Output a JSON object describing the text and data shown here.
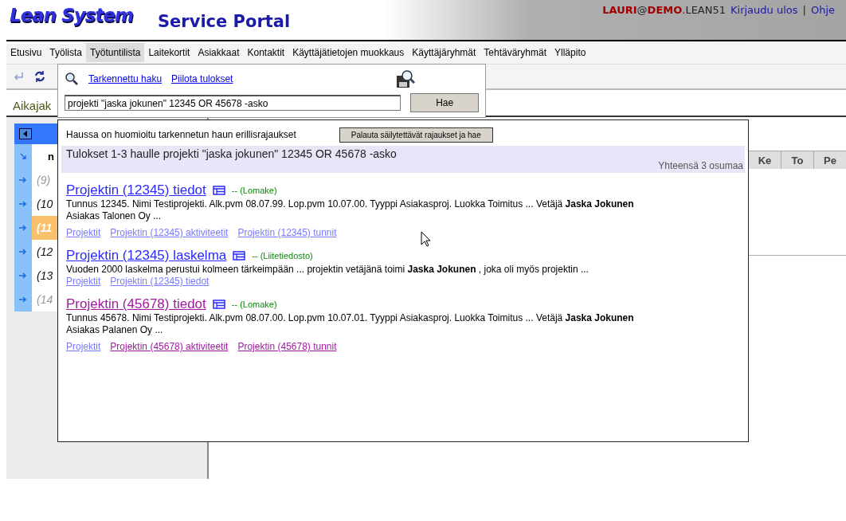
{
  "header": {
    "logo": "Lean System",
    "title": "Service Portal",
    "user": [
      {
        "text": "LAURI",
        "highlight": true
      },
      {
        "text": "@",
        "highlight": false
      },
      {
        "text": "DEMO",
        "highlight": true
      },
      {
        "text": ".LEAN51",
        "highlight": false
      }
    ],
    "links": [
      "Kirjaudu ulos",
      "Ohje"
    ],
    "separator": "|"
  },
  "menu": [
    {
      "label": "Etusivu",
      "selected": false
    },
    {
      "label": "Työlista",
      "selected": false
    },
    {
      "label": "Työtuntilista",
      "selected": true
    },
    {
      "label": "Laitekortit",
      "selected": false
    },
    {
      "label": "Asiakkaat",
      "selected": false
    },
    {
      "label": "Kontaktit",
      "selected": false
    },
    {
      "label": "Käyttäjätietojen muokkaus",
      "selected": false
    },
    {
      "label": "Käyttäjäryhmät",
      "selected": false
    },
    {
      "label": "Tehtäväryhmät",
      "selected": false
    },
    {
      "label": "Ylläpito",
      "selected": false
    }
  ],
  "tab_label": "Aikajak",
  "left_list": {
    "heading": "n",
    "rows": [
      {
        "label": "(9)",
        "selected": false,
        "dimmed": true
      },
      {
        "label": "(10",
        "selected": false,
        "dimmed": false
      },
      {
        "label": "(11",
        "selected": true,
        "dimmed": false
      },
      {
        "label": "(12",
        "selected": false,
        "dimmed": false
      },
      {
        "label": "(13",
        "selected": false,
        "dimmed": false
      },
      {
        "label": "(14",
        "selected": false,
        "dimmed": true
      }
    ]
  },
  "day_columns": [
    "Ke",
    "To",
    "Pe"
  ],
  "search": {
    "links": [
      "Tarkennettu haku",
      "Piilota tulokset"
    ],
    "value": "projekti \"jaska jokunen\" 12345 OR 45678 -asko",
    "button": "Hae"
  },
  "results": {
    "notice": "Haussa on huomioitu tarkennetun haun erillisrajaukset",
    "restore_button": "Palauta säilytettävät rajaukset ja hae",
    "summary": "Tulokset 1-3 haulle projekti \"jaska jokunen\" 12345 OR 45678 -asko",
    "count": "Yhteensä 3 osumaa",
    "items": [
      {
        "title": "Projektin (12345) tiedot",
        "visited": false,
        "type": "-- (Lomake)",
        "snippet": "Tunnus 12345. Nimi Testiprojekti. Alk.pvm 08.07.99. Lop.pvm 10.07.00. Tyyppi Asiakasproj. Luokka Toimitus ... Vetäjä **Jaska Jokunen**",
        "snippet_2": "Asiakas Talonen Oy ...",
        "links": [
          {
            "label": "Projektit",
            "visited": false
          },
          {
            "label": "Projektin (12345) aktiviteetit",
            "visited": false
          },
          {
            "label": "Projektin (12345) tunnit",
            "visited": false
          }
        ]
      },
      {
        "title": "Projektin (12345) laskelma",
        "visited": false,
        "type": "-- (Liitetiedosto)",
        "snippet": "Vuoden 2000 laskelma perustui kolmeen tärkeimpään ... projektin vetäjänä toimi **Jaska Jokunen** , joka oli myös projektin ...",
        "links": [
          {
            "label": "Projektit",
            "visited": false
          },
          {
            "label": "Projektin (12345) tiedot",
            "visited": false
          }
        ]
      },
      {
        "title": "Projektin (45678) tiedot",
        "visited": true,
        "type": "-- (Lomake)",
        "snippet": "Tunnus 45678. Nimi Testiprojekti. Alk.pvm 08.07.00. Lop.pvm 10.07.01. Tyyppi Asiakasproj. Luokka Toimitus ... Vetäjä **Jaska Jokunen**",
        "snippet_2": "Asiakas Palanen Oy ...",
        "links": [
          {
            "label": "Projektit",
            "visited": false
          },
          {
            "label": "Projektin (45678) aktiviteetit",
            "visited": true
          },
          {
            "label": "Projektin (45678) tunnit",
            "visited": true
          }
        ]
      }
    ]
  }
}
